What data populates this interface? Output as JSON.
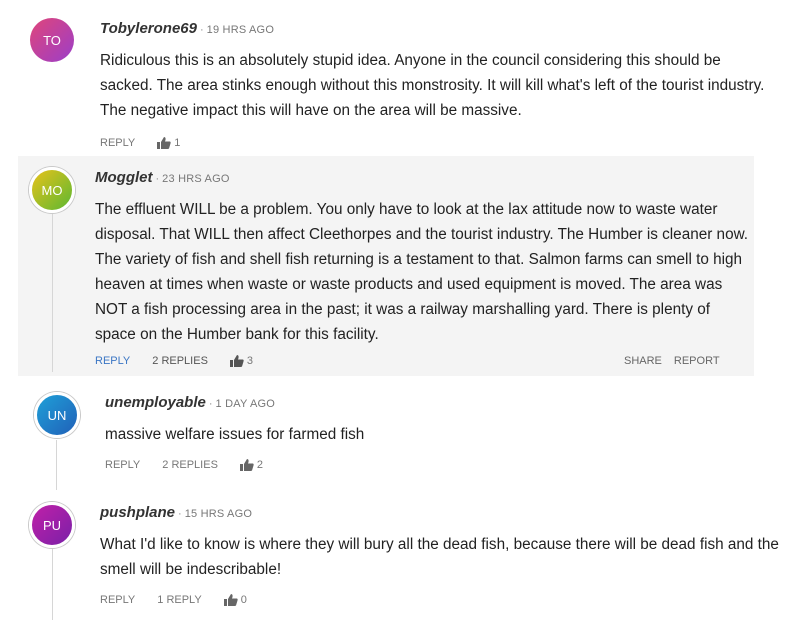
{
  "comments": [
    {
      "initials": "TO",
      "avatar_color": "#b03fb8",
      "user": "Tobylerone69",
      "time": "19 HRS AGO",
      "text": "Ridiculous this is an absolutely stupid idea. Anyone in the council considering this should be sacked. The area stinks enough without this monstrosity. It will kill what's left of the tourist industry. The negative impact this will have on the area will be massive.",
      "reply": "REPLY",
      "likes": "1"
    },
    {
      "initials": "MO",
      "avatar_color": "#8fb320",
      "user": "Mogglet",
      "time": "23 HRS AGO",
      "text": "The effluent WILL be a problem. You only have to look at the lax attitude now to waste water disposal. That WILL then affect Cleethorpes and the tourist industry. The Humber is cleaner now. The variety of fish and shell fish returning is a testament to that. Salmon farms can smell to high heaven at times when waste or waste products and used equipment is moved. The area was NOT a fish processing area in the past; it was a railway marshalling yard. There is plenty of space on the Humber bank for this facility.",
      "reply": "REPLY",
      "replies": "2 REPLIES",
      "likes": "3",
      "share": "SHARE",
      "report": "REPORT"
    },
    {
      "initials": "UN",
      "avatar_color": "#1f78c8",
      "user": "unemployable",
      "time": "1 DAY AGO",
      "text": "massive welfare issues for farmed fish",
      "reply": "REPLY",
      "replies": "2 REPLIES",
      "likes": "2"
    },
    {
      "initials": "PU",
      "avatar_color": "#9b1fa8",
      "user": "pushplane",
      "time": "15 HRS AGO",
      "text": "What I'd like to know is where they will bury all the dead fish, because there will be dead fish and the smell will be indescribable!",
      "reply": "REPLY",
      "replies": "1 REPLY",
      "likes": "0"
    }
  ]
}
